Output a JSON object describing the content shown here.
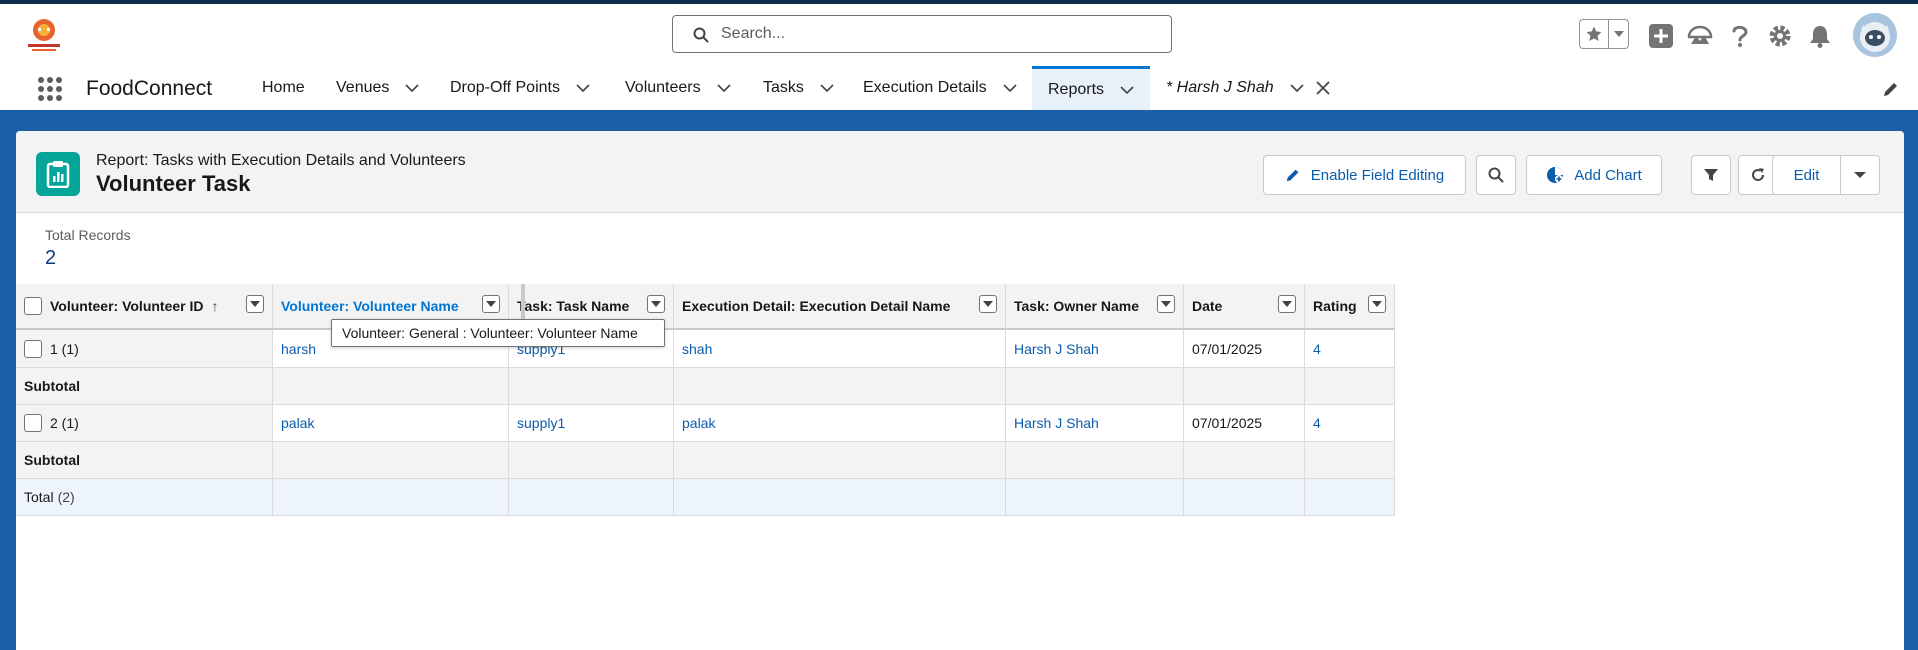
{
  "header": {
    "search_placeholder": "Search..."
  },
  "nav": {
    "app_name": "FoodConnect",
    "items": [
      {
        "label": "Home"
      },
      {
        "label": "Venues"
      },
      {
        "label": "Drop-Off Points"
      },
      {
        "label": "Volunteers"
      },
      {
        "label": "Tasks"
      },
      {
        "label": "Execution Details"
      },
      {
        "label": "Reports"
      },
      {
        "label": "* Harsh J Shah"
      }
    ]
  },
  "report": {
    "type_label": "Report: Tasks with Execution Details and Volunteers",
    "title": "Volunteer Task",
    "buttons": {
      "enable_field_editing": "Enable Field Editing",
      "add_chart": "Add Chart",
      "edit": "Edit"
    },
    "summary": {
      "label": "Total Records",
      "value": "2"
    }
  },
  "table": {
    "columns": [
      "Volunteer: Volunteer ID",
      "Volunteer: Volunteer Name",
      "Task: Task Name",
      "Execution Detail: Execution Detail Name",
      "Task: Owner Name",
      "Date",
      "Rating"
    ],
    "groups": [
      {
        "group_label": "1 (1)",
        "cells": [
          "harsh",
          "supply1",
          "shah",
          "Harsh J Shah",
          "07/01/2025",
          "4"
        ],
        "subtotal_label": "Subtotal"
      },
      {
        "group_label": "2 (1)",
        "cells": [
          "palak",
          "supply1",
          "palak",
          "Harsh J Shah",
          "07/01/2025",
          "4"
        ],
        "subtotal_label": "Subtotal"
      }
    ],
    "total_label": "Total",
    "total_count": "(2)",
    "tooltip": "Volunteer: General : Volunteer: Volunteer Name"
  },
  "colors": {
    "brand_blue": "#1b5fa6",
    "link": "#0b5cab",
    "report_icon": "#06a59a"
  }
}
